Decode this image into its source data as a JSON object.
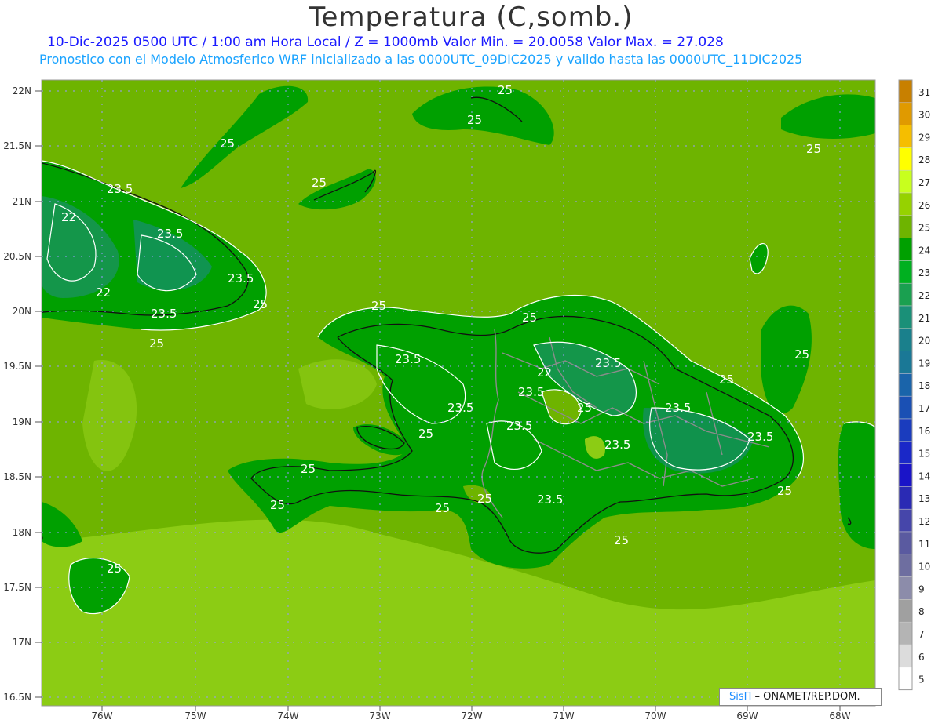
{
  "title": "Temperatura (C,somb.)",
  "subtitle_line1": "10-Dic-2025  0500 UTC / 1:00 am Hora Local / Z = 1000mb    Valor Min. = 20.0058  Valor Max. = 27.028",
  "subtitle_line2": "Pronostico con el Modelo Atmosferico WRF inicializado a las 0000UTC_09DIC2025 y valido hasta las  0000UTC_11DIC2025",
  "credit": {
    "brand": "SisΠ",
    "text": " – ONAMET/REP.DOM."
  },
  "axes": {
    "lat_labels": [
      "22N",
      "21.5N",
      "21N",
      "20.5N",
      "20N",
      "19.5N",
      "19N",
      "18.5N",
      "18N",
      "17.5N",
      "17N",
      "16.5N"
    ],
    "lon_labels": [
      "76W",
      "75W",
      "74W",
      "73W",
      "72W",
      "71W",
      "70W",
      "69W",
      "68W"
    ]
  },
  "colorbar": {
    "labels": [
      "31",
      "30",
      "29",
      "28",
      "27",
      "26",
      "25",
      "24",
      "23",
      "22",
      "21",
      "20",
      "19",
      "18",
      "17",
      "16",
      "15",
      "14",
      "13",
      "12",
      "11",
      "10",
      "9",
      "8",
      "7",
      "6",
      "5"
    ],
    "colors": [
      "#c88000",
      "#e09a00",
      "#f5be00",
      "#ffff00",
      "#c8ff1e",
      "#96d200",
      "#6eb400",
      "#00a000",
      "#00b020",
      "#1aa050",
      "#1a9078",
      "#1a808c",
      "#1a7896",
      "#1a64aa",
      "#1a50b4",
      "#1a3cbe",
      "#1a28c8",
      "#1a14c8",
      "#2a2ab4",
      "#4646aa",
      "#5a5aa0",
      "#6e6ea0",
      "#8c8caa",
      "#a0a0a0",
      "#b4b4b4",
      "#dcdcdc",
      "#ffffff"
    ]
  },
  "contour_labels": [
    {
      "text": "25"
    },
    {
      "text": "25"
    },
    {
      "text": "25"
    },
    {
      "text": "25"
    },
    {
      "text": "25"
    },
    {
      "text": "25"
    },
    {
      "text": "23.5"
    },
    {
      "text": "22"
    },
    {
      "text": "23.5"
    },
    {
      "text": "23.5"
    },
    {
      "text": "22"
    },
    {
      "text": "23.5"
    },
    {
      "text": "25"
    },
    {
      "text": "25"
    },
    {
      "text": "25"
    },
    {
      "text": "25"
    },
    {
      "text": "23.5"
    },
    {
      "text": "22"
    },
    {
      "text": "23.5"
    },
    {
      "text": "23.5"
    },
    {
      "text": "25"
    },
    {
      "text": "23.5"
    },
    {
      "text": "25"
    },
    {
      "text": "23.5"
    },
    {
      "text": "25"
    },
    {
      "text": "23.5"
    },
    {
      "text": "23.5"
    },
    {
      "text": "23.5"
    },
    {
      "text": "25"
    },
    {
      "text": "25"
    },
    {
      "text": "25"
    },
    {
      "text": "25"
    },
    {
      "text": "23.5"
    },
    {
      "text": "25"
    },
    {
      "text": "25"
    },
    {
      "text": "25"
    }
  ],
  "colors": {
    "sea_far": "#8ccc14",
    "sea_near": "#6eb400",
    "land": "#00a000",
    "land_cool": "#14964a",
    "contour": "#ffffff",
    "coast": "#111111",
    "border": "#8c8c8c"
  }
}
